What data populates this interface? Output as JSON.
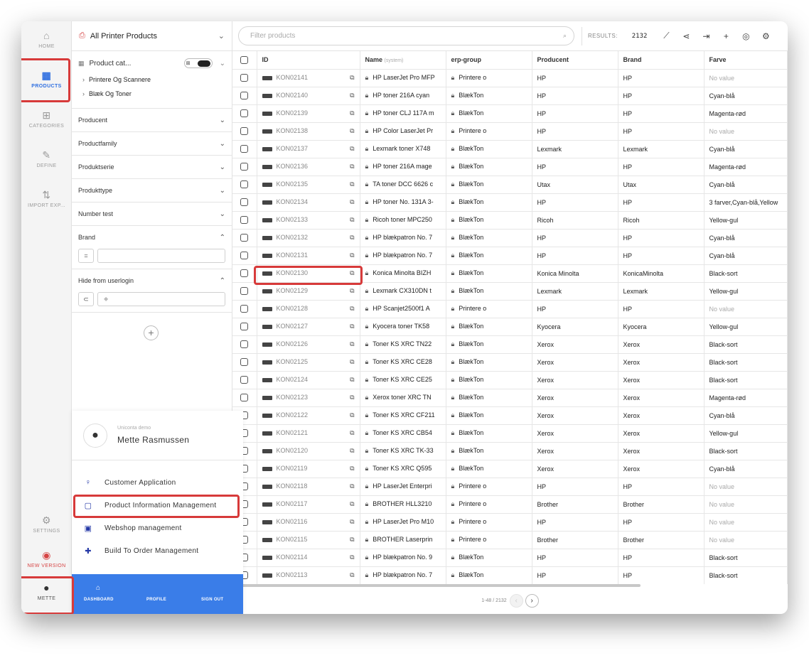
{
  "rail": {
    "home": "HOME",
    "products": "PRODUCTS",
    "categories": "CATEGORIES",
    "define": "DEFINE",
    "import_export": "IMPORT EXP...",
    "settings": "SETTINGS",
    "new_version": "NEW VERSION",
    "user": "METTE"
  },
  "panel": {
    "title": "All Printer Products",
    "tree_label": "Product cat...",
    "tree_nodes": [
      "Printere Og Scannere",
      "Blæk Og Toner"
    ],
    "facets": [
      "Producent",
      "Productfamily",
      "Produktserie",
      "Produkttype",
      "Number test"
    ],
    "brand": {
      "label": "Brand",
      "operator": "="
    },
    "hide": {
      "label": "Hide from userlogin",
      "operator": "⊂"
    }
  },
  "toolbar": {
    "search_placeholder": "Filter products",
    "results_label": "RESULTS:",
    "results_count": "2132"
  },
  "table": {
    "columns": [
      "ID",
      "Name",
      "(system)",
      "erp-group",
      "Producent",
      "Brand",
      "Farve"
    ],
    "rows": [
      [
        "KON02141",
        "HP LaserJet Pro MFP",
        "Printere o",
        "HP",
        "HP",
        "No value"
      ],
      [
        "KON02140",
        "HP toner 216A cyan",
        "BlækTon",
        "HP",
        "HP",
        "Cyan-blå"
      ],
      [
        "KON02139",
        "HP toner CLJ 117A m",
        "BlækTon",
        "HP",
        "HP",
        "Magenta-rød"
      ],
      [
        "KON02138",
        "HP Color LaserJet Pr",
        "Printere o",
        "HP",
        "HP",
        "No value"
      ],
      [
        "KON02137",
        "Lexmark toner X748",
        "BlækTon",
        "Lexmark",
        "Lexmark",
        "Cyan-blå"
      ],
      [
        "KON02136",
        "HP toner 216A mage",
        "BlækTon",
        "HP",
        "HP",
        "Magenta-rød"
      ],
      [
        "KON02135",
        "TA toner DCC 6626 c",
        "BlækTon",
        "Utax",
        "Utax",
        "Cyan-blå"
      ],
      [
        "KON02134",
        "HP toner No. 131A 3-",
        "BlækTon",
        "HP",
        "HP",
        "3 farver,Cyan-blå,Yellow"
      ],
      [
        "KON02133",
        "Ricoh toner MPC250",
        "BlækTon",
        "Ricoh",
        "Ricoh",
        "Yellow-gul"
      ],
      [
        "KON02132",
        "HP blækpatron No. 7",
        "BlækTon",
        "HP",
        "HP",
        "Cyan-blå"
      ],
      [
        "KON02131",
        "HP blækpatron No. 7",
        "BlækTon",
        "HP",
        "HP",
        "Cyan-blå"
      ],
      [
        "KON02130",
        "Konica Minolta BIZH",
        "BlækTon",
        "Konica Minolta",
        "KonicaMinolta",
        "Black-sort"
      ],
      [
        "KON02129",
        "Lexmark CX310DN t",
        "BlækTon",
        "Lexmark",
        "Lexmark",
        "Yellow-gul"
      ],
      [
        "KON02128",
        "HP Scanjet2500f1 A",
        "Printere o",
        "HP",
        "HP",
        "No value"
      ],
      [
        "KON02127",
        "Kyocera toner TK58",
        "BlækTon",
        "Kyocera",
        "Kyocera",
        "Yellow-gul"
      ],
      [
        "KON02126",
        "Toner KS XRC TN22",
        "BlækTon",
        "Xerox",
        "Xerox",
        "Black-sort"
      ],
      [
        "KON02125",
        "Toner KS XRC CE28",
        "BlækTon",
        "Xerox",
        "Xerox",
        "Black-sort"
      ],
      [
        "KON02124",
        "Toner KS XRC CE25",
        "BlækTon",
        "Xerox",
        "Xerox",
        "Black-sort"
      ],
      [
        "KON02123",
        "Xerox toner XRC TN",
        "BlækTon",
        "Xerox",
        "Xerox",
        "Magenta-rød"
      ],
      [
        "KON02122",
        "Toner KS XRC CF211",
        "BlækTon",
        "Xerox",
        "Xerox",
        "Cyan-blå"
      ],
      [
        "KON02121",
        "Toner KS XRC CB54",
        "BlækTon",
        "Xerox",
        "Xerox",
        "Yellow-gul"
      ],
      [
        "KON02120",
        "Toner KS XRC TK-33",
        "BlækTon",
        "Xerox",
        "Xerox",
        "Black-sort"
      ],
      [
        "KON02119",
        "Toner KS XRC Q595",
        "BlækTon",
        "Xerox",
        "Xerox",
        "Cyan-blå"
      ],
      [
        "KON02118",
        "HP LaserJet Enterpri",
        "Printere o",
        "HP",
        "HP",
        "No value"
      ],
      [
        "KON02117",
        "BROTHER HLL3210",
        "Printere o",
        "Brother",
        "Brother",
        "No value"
      ],
      [
        "KON02116",
        "HP LaserJet Pro M10",
        "Printere o",
        "HP",
        "HP",
        "No value"
      ],
      [
        "KON02115",
        "BROTHER Laserprin",
        "Printere o",
        "Brother",
        "Brother",
        "No value"
      ],
      [
        "KON02114",
        "HP blækpatron No. 9",
        "BlækTon",
        "HP",
        "HP",
        "Black-sort"
      ],
      [
        "KON02113",
        "HP blækpatron No. 7",
        "BlækTon",
        "HP",
        "HP",
        "Black-sort"
      ]
    ]
  },
  "pager": {
    "range": "1-48 / 2132"
  },
  "account": {
    "org": "Uniconta demo",
    "name": "Mette Rasmussen",
    "apps": [
      "Customer Application",
      "Product Information Management",
      "Webshop management",
      "Build To Order Management"
    ],
    "footer": {
      "dashboard": "DASHBOARD",
      "profile": "PROFILE",
      "signout": "SIGN OUT"
    }
  },
  "colors": {
    "accent": "#2f6fe0",
    "highlight": "#d73a3a",
    "footer": "#3a7de8"
  }
}
